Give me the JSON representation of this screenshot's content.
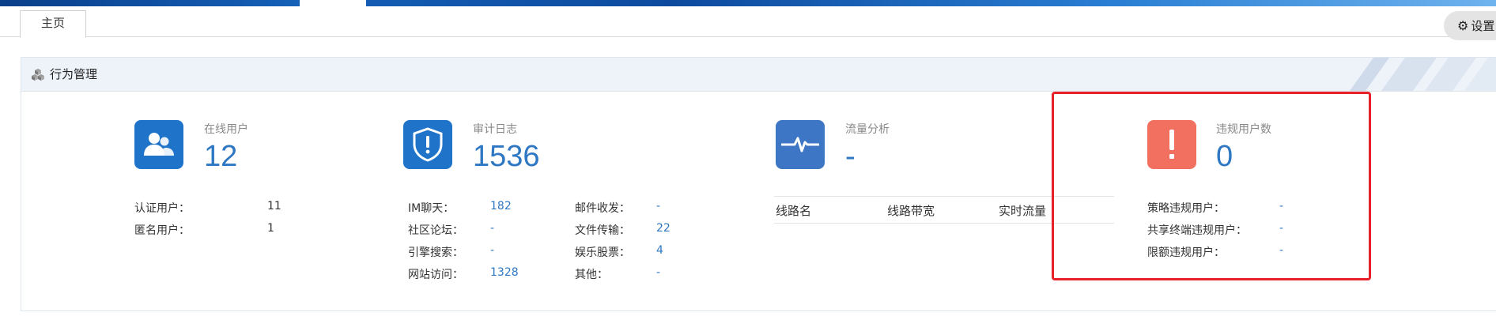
{
  "tabs": {
    "home": "主页"
  },
  "settings": {
    "label": "设置"
  },
  "panel": {
    "title": "行为管理"
  },
  "online_users": {
    "label": "在线用户",
    "value": "12",
    "items": [
      {
        "k": "认证用户：",
        "v": "11"
      },
      {
        "k": "匿名用户：",
        "v": "1"
      }
    ]
  },
  "audit_log": {
    "label": "审计日志",
    "value": "1536",
    "items_left": [
      {
        "k": "IM聊天：",
        "v": "182"
      },
      {
        "k": "社区论坛：",
        "v": "-"
      },
      {
        "k": "引擎搜索：",
        "v": "-"
      },
      {
        "k": "网站访问：",
        "v": "1328"
      }
    ],
    "items_right": [
      {
        "k": "邮件收发：",
        "v": "-"
      },
      {
        "k": "文件传输：",
        "v": "22"
      },
      {
        "k": "娱乐股票：",
        "v": "4"
      },
      {
        "k": "其他：",
        "v": "-"
      }
    ]
  },
  "traffic": {
    "label": "流量分析",
    "value": "-",
    "columns": [
      "线路名",
      "线路带宽",
      "实时流量"
    ]
  },
  "violations": {
    "label": "违规用户数",
    "value": "0",
    "items": [
      {
        "k": "策略违规用户：",
        "v": "-"
      },
      {
        "k": "共享终端违规用户：",
        "v": "-"
      },
      {
        "k": "限额违规用户：",
        "v": "-"
      }
    ]
  },
  "colors": {
    "accent": "#2e77c3",
    "badge_blue": "#1f73c9",
    "badge_red": "#f2705f",
    "highlight": "#e8202a"
  },
  "icons": [
    "users-icon",
    "shield-alert-icon",
    "pulse-icon",
    "exclamation-icon",
    "gear-icon",
    "cubes-icon"
  ]
}
